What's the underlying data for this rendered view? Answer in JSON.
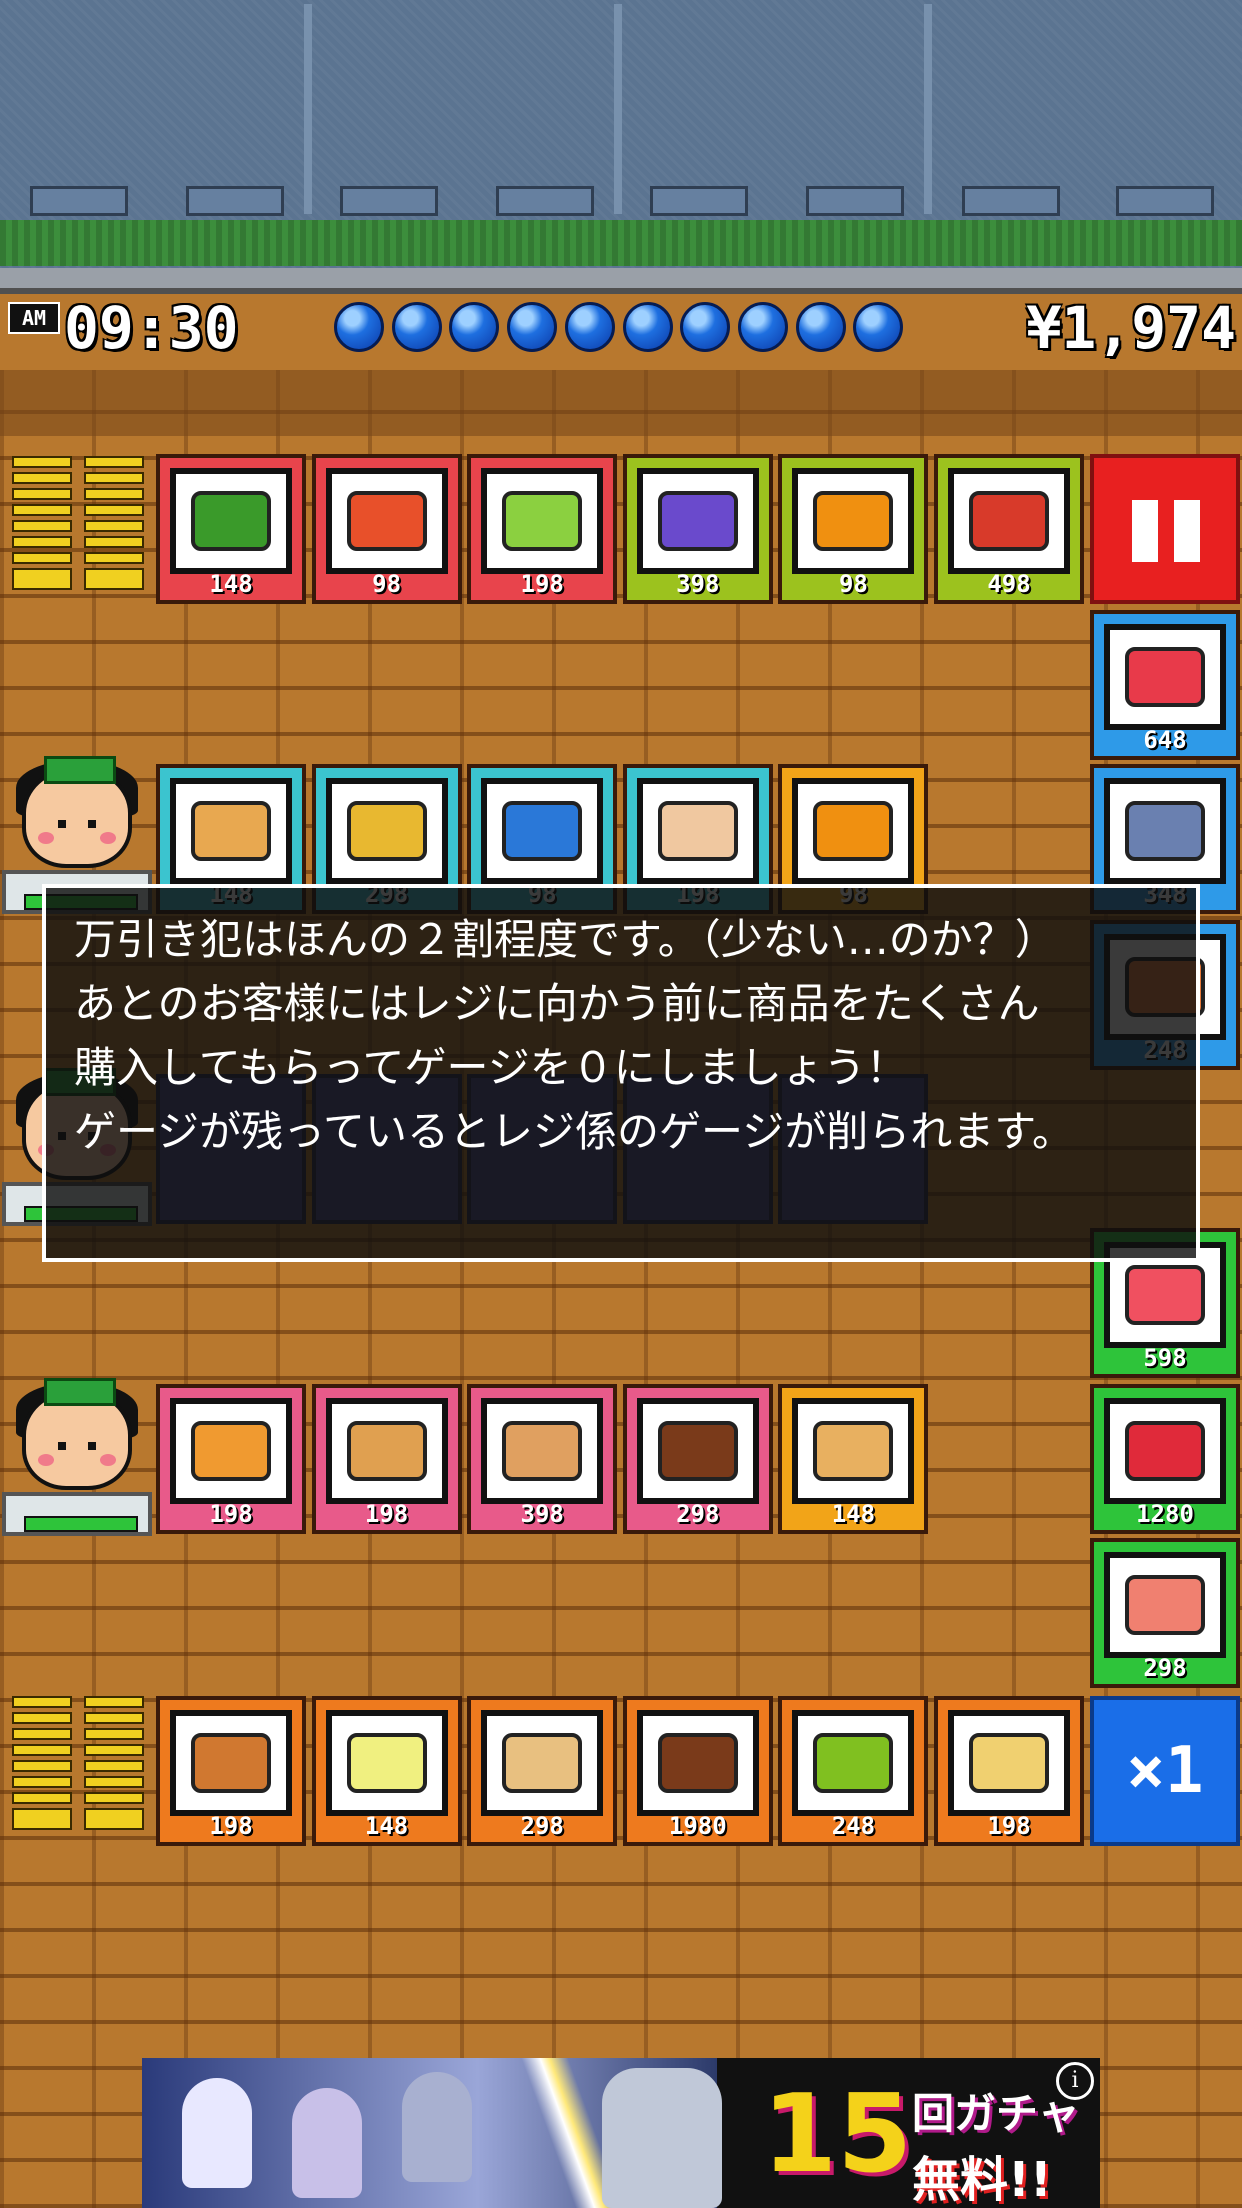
{
  "hud": {
    "ampm": "AM",
    "clock": "09:30",
    "money": "¥1,974",
    "lives": 10
  },
  "rows": [
    {
      "id": "row1",
      "tiles": [
        {
          "name": "watermelon-slice",
          "price": "148",
          "color": "#e8444c",
          "item_color": "#3a9a2a"
        },
        {
          "name": "salmon-fillet",
          "price": "98",
          "color": "#e8444c",
          "item_color": "#e8502a"
        },
        {
          "name": "cabbage",
          "price": "198",
          "color": "#e8444c",
          "item_color": "#8bd040"
        },
        {
          "name": "grape-pack",
          "price": "398",
          "color": "#9cc21e",
          "item_color": "#6a4acc"
        },
        {
          "name": "orange",
          "price": "98",
          "color": "#9cc21e",
          "item_color": "#f09010"
        },
        {
          "name": "gift-box",
          "price": "498",
          "color": "#9cc21e",
          "item_color": "#d83a2a"
        }
      ]
    },
    {
      "id": "row2",
      "tiles": [
        {
          "name": "bread-loaf",
          "price": "148",
          "color": "#3bc4cf",
          "item_color": "#e8a850"
        },
        {
          "name": "egg-omelet",
          "price": "298",
          "color": "#3bc4cf",
          "item_color": "#e8b830"
        },
        {
          "name": "milk-carton",
          "price": "98",
          "color": "#3bc4cf",
          "item_color": "#2a78d8"
        },
        {
          "name": "tofu-pack",
          "price": "198",
          "color": "#3bc4cf",
          "item_color": "#f0c8a0"
        },
        {
          "name": "orange-crate",
          "price": "98",
          "color": "#f2a418",
          "item_color": "#f09010"
        }
      ]
    },
    {
      "id": "row3",
      "tiles": [
        {
          "name": "cake-slice",
          "price": "198",
          "color": "#e85a8a",
          "item_color": "#f09a30"
        },
        {
          "name": "bento-box",
          "price": "198",
          "color": "#e85a8a",
          "item_color": "#e0a050"
        },
        {
          "name": "pudding",
          "price": "398",
          "color": "#e85a8a",
          "item_color": "#e0a060"
        },
        {
          "name": "chocolate-bar",
          "price": "298",
          "color": "#e85a8a",
          "item_color": "#7a3a1a"
        },
        {
          "name": "cracker-box",
          "price": "148",
          "color": "#f2a418",
          "item_color": "#e8b060"
        }
      ]
    },
    {
      "id": "row4",
      "tiles": [
        {
          "name": "bun",
          "price": "198",
          "color": "#ee7a1e",
          "item_color": "#d07830"
        },
        {
          "name": "noodle-bowl",
          "price": "148",
          "color": "#ee7a1e",
          "item_color": "#f0f080"
        },
        {
          "name": "cookie-box",
          "price": "298",
          "color": "#ee7a1e",
          "item_color": "#e8c080"
        },
        {
          "name": "coffee-mug",
          "price": "1980",
          "color": "#ee7a1e",
          "item_color": "#7a3a1a"
        },
        {
          "name": "matcha-pack",
          "price": "248",
          "color": "#ee7a1e",
          "item_color": "#80c020"
        },
        {
          "name": "beer-mug",
          "price": "198",
          "color": "#ee7a1e",
          "item_color": "#f0d070"
        }
      ]
    }
  ],
  "sidebar": {
    "pause_label": "pause",
    "speed_label": "×1",
    "items": [
      {
        "name": "meat-tray-red",
        "price": "648",
        "color": "#2e9ae8",
        "item_color": "#e83a4a"
      },
      {
        "name": "fish-tray",
        "price": "348",
        "color": "#2e9ae8",
        "item_color": "#6a80b0"
      },
      {
        "name": "side-tray-3",
        "price": "248",
        "color": "#2e9ae8",
        "item_color": "#e87a3a"
      },
      {
        "name": "tuna-tray",
        "price": "598",
        "color": "#2ec43a",
        "item_color": "#f05060"
      },
      {
        "name": "beef-tray",
        "price": "1280",
        "color": "#2ec43a",
        "item_color": "#e02a3a"
      },
      {
        "name": "salmon-tray",
        "price": "298",
        "color": "#2ec43a",
        "item_color": "#f08070"
      }
    ]
  },
  "dialog": {
    "lines": [
      "万引き犯はほんの２割程度です。（少ない…のか？）",
      "あとのお客様にはレジに向かう前に商品をたくさん",
      "購入してもらってゲージを０にしましょう！",
      "ゲージが残っているとレジ係のゲージが削られます。"
    ]
  },
  "ad": {
    "number": "15",
    "line1": "回ガチャ",
    "line2": "無料!!",
    "info": "i"
  }
}
